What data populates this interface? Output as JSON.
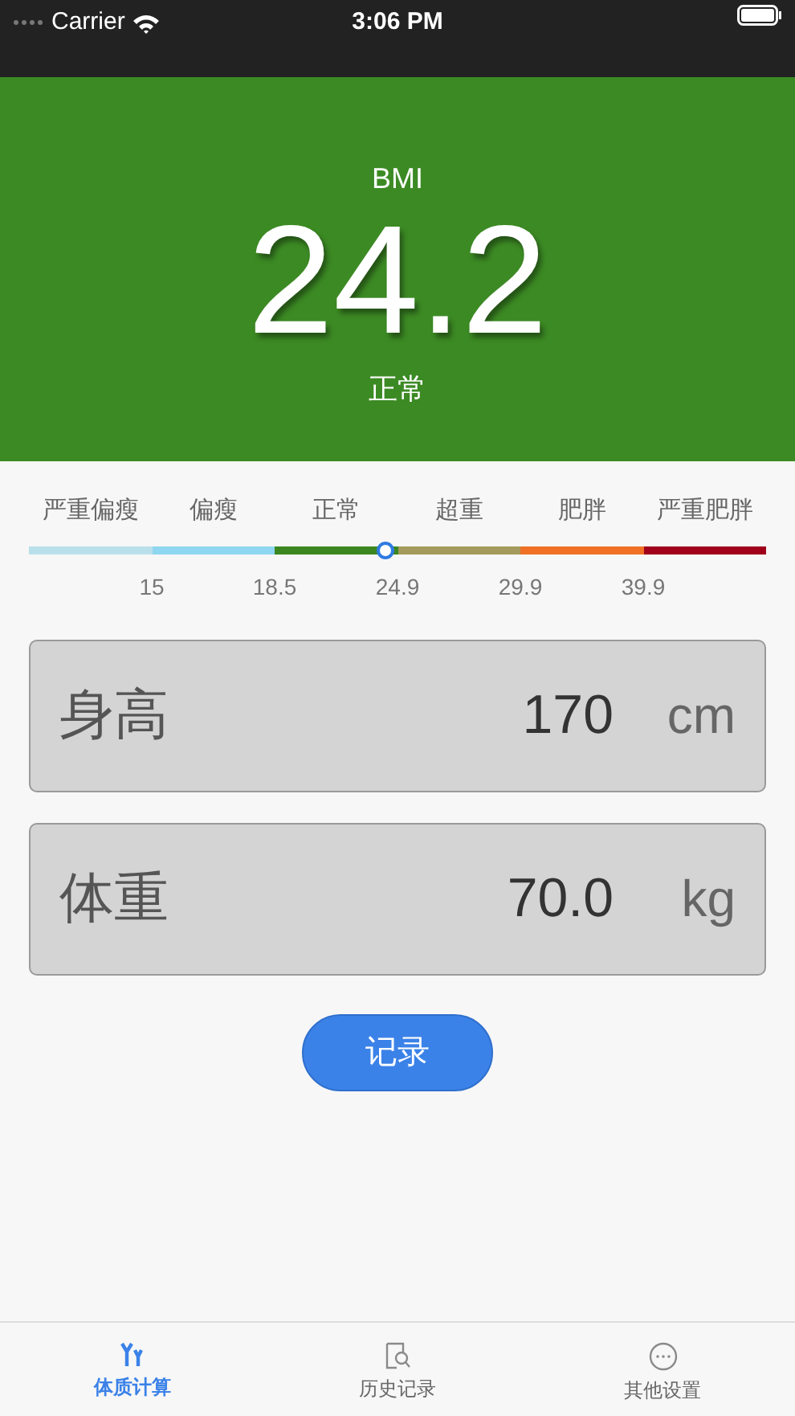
{
  "status_bar": {
    "carrier": "Carrier",
    "time": "3:06 PM"
  },
  "result": {
    "label": "BMI",
    "value": "24.2",
    "category": "正常"
  },
  "scale": {
    "level": 0.484,
    "segments": [
      {
        "label": "严重偏瘦",
        "color": "#b9e0ea"
      },
      {
        "label": "偏瘦",
        "color": "#8fd6f0"
      },
      {
        "label": "正常",
        "color": "#3c8620"
      },
      {
        "label": "超重",
        "color": "#a39a5c"
      },
      {
        "label": "肥胖",
        "color": "#f07025"
      },
      {
        "label": "严重肥胖",
        "color": "#a0001c"
      }
    ],
    "ticks": [
      "15",
      "18.5",
      "24.9",
      "29.9",
      "39.9"
    ]
  },
  "fields": [
    {
      "label": "身高",
      "value": "170",
      "unit": "cm"
    },
    {
      "label": "体重",
      "value": "70.0",
      "unit": "kg"
    }
  ],
  "record_button": "记录",
  "tabs": [
    {
      "label": "体质计算",
      "selected": true,
      "kind": "calc"
    },
    {
      "label": "历史记录",
      "selected": false,
      "kind": "history"
    },
    {
      "label": "其他设置",
      "selected": false,
      "kind": "more"
    }
  ]
}
